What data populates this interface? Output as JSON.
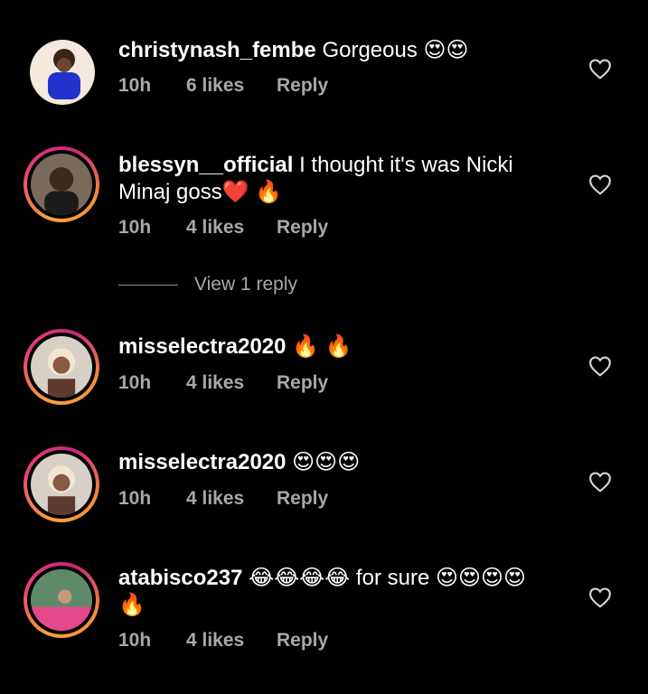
{
  "comments": [
    {
      "username": "christynash_fembe",
      "text": "Gorgeous 😍😍",
      "time": "10h",
      "likes": "6 likes",
      "reply": "Reply"
    },
    {
      "username": "blessyn__official",
      "text": "I thought it's was Nicki Minaj goss❤️ 🔥",
      "time": "10h",
      "likes": "4 likes",
      "reply": "Reply"
    },
    {
      "username": "misselectra2020",
      "text": "🔥 🔥",
      "time": "10h",
      "likes": "4 likes",
      "reply": "Reply"
    },
    {
      "username": "misselectra2020",
      "text": "😍😍😍",
      "time": "10h",
      "likes": "4 likes",
      "reply": "Reply"
    },
    {
      "username": "atabisco237",
      "text": "😂😂😂😂 for sure 😍😍😍😍🔥",
      "time": "10h",
      "likes": "4 likes",
      "reply": "Reply"
    }
  ],
  "view_replies": "View 1 reply",
  "icons": {
    "like": "heart-outline-icon"
  },
  "colors": {
    "background": "#000000",
    "meta": "#a8a8a8",
    "story_ring": "#e6407a"
  }
}
